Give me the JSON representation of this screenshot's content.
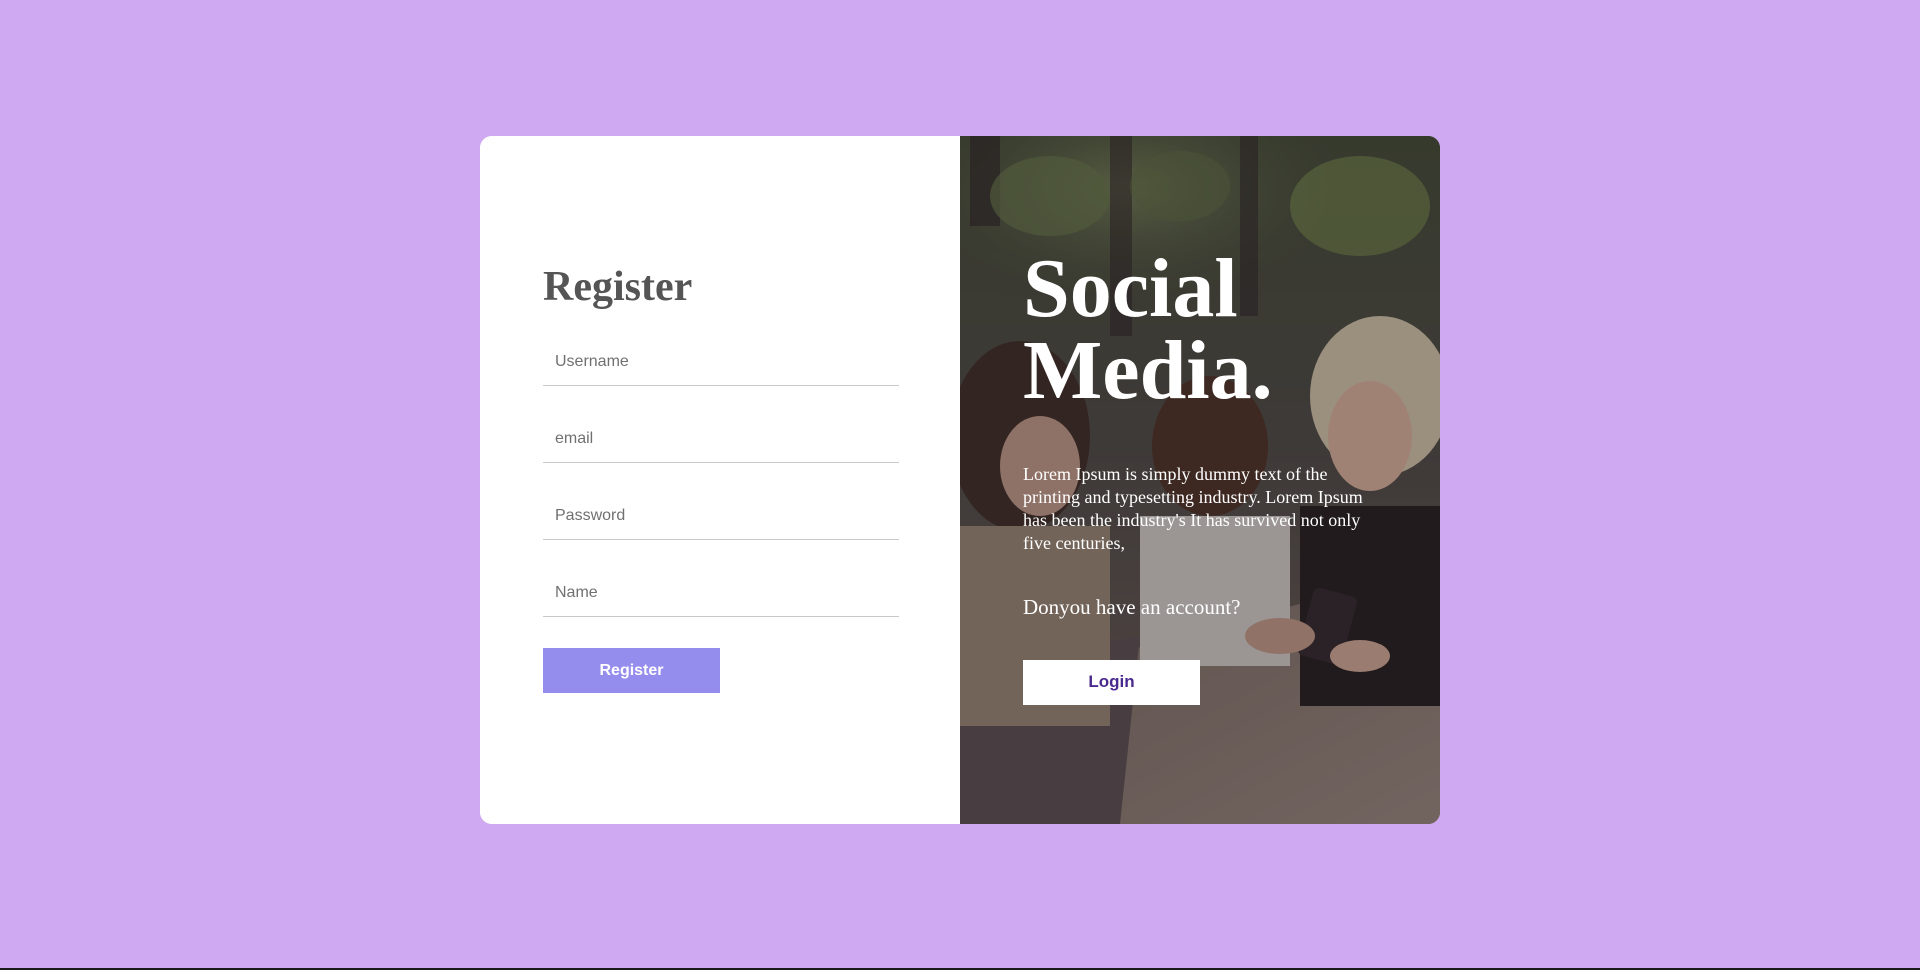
{
  "register": {
    "title": "Register",
    "username_placeholder": "Username",
    "email_placeholder": "email",
    "password_placeholder": "Password",
    "name_placeholder": "Name",
    "button_label": "Register"
  },
  "promo": {
    "title_line1": "Social",
    "title_line2": "Media.",
    "description": "Lorem Ipsum is simply dummy text of the printing and typesetting industry. Lorem Ipsum has been the industry's It has survived not only five centuries,",
    "account_question": "Donyou have an account?",
    "login_label": "Login"
  },
  "colors": {
    "background": "#cfa9f1",
    "register_button": "#958ded",
    "login_text": "#4b2a8f",
    "heading": "#555555"
  }
}
